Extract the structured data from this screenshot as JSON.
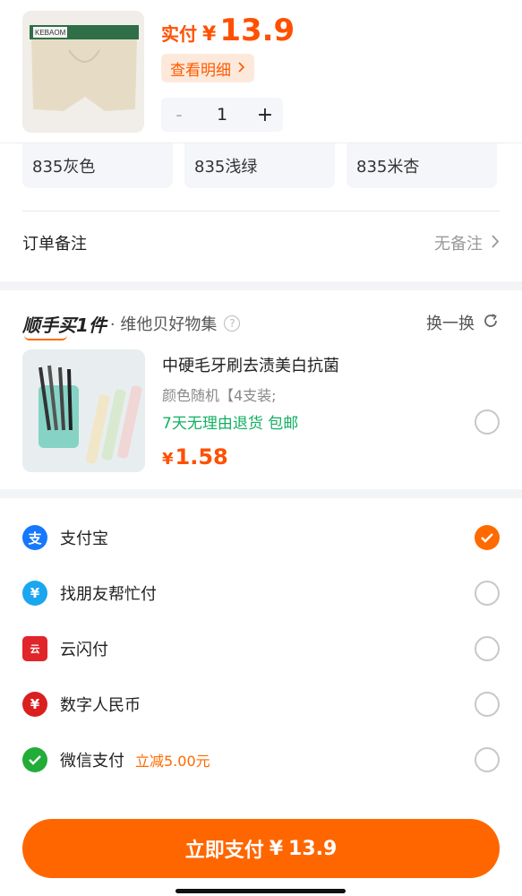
{
  "product": {
    "price_label": "实付",
    "currency": "¥",
    "price": "13.9",
    "detail_label": "查看明细",
    "quantity": "1",
    "brand_text": "KEBAOM",
    "minus": "-",
    "plus": "+"
  },
  "colors": [
    "835灰色",
    "835浅绿",
    "835米杏"
  ],
  "remark": {
    "label": "订单备注",
    "value": "无备注"
  },
  "bundle": {
    "title": "顺手买1件",
    "subtitle": "· 维他贝好物集",
    "refresh_label": "换一换",
    "item": {
      "title": "中硬毛牙刷去渍美白抗菌",
      "spec": "颜色随机【4支装;",
      "tags": "7天无理由退货  包邮",
      "currency": "¥",
      "price": "1.58"
    }
  },
  "payments": [
    {
      "label": "支付宝",
      "icon": "alipay-icon",
      "color": "#1677ff",
      "glyph": "支",
      "checked": true
    },
    {
      "label": "找朋友帮忙付",
      "icon": "friend-pay-icon",
      "color": "#1aa7f0",
      "glyph": "¥",
      "checked": false
    },
    {
      "label": "云闪付",
      "icon": "unionpay-icon",
      "color": "#e0252b",
      "glyph": "云",
      "checked": false
    },
    {
      "label": "数字人民币",
      "icon": "ecny-icon",
      "color": "#d9201f",
      "glyph": "¥",
      "checked": false
    },
    {
      "label": "微信支付",
      "icon": "wechat-pay-icon",
      "color": "#22ac38",
      "glyph": "✓",
      "checked": false,
      "promo": "立减5.00元"
    }
  ],
  "pay_button": {
    "label": "立即支付",
    "currency": "¥",
    "amount": "13.9"
  },
  "colors_theme": {
    "accent": "#ff6600",
    "price": "#ff5000",
    "green": "#11b062"
  }
}
